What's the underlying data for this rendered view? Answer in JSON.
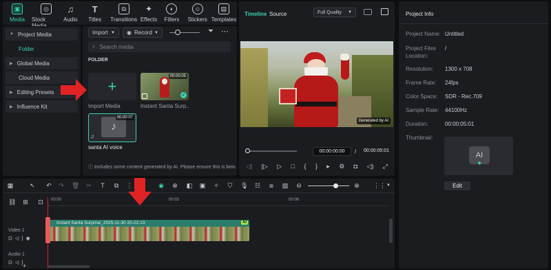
{
  "toolbar": {
    "tabs": [
      {
        "label": "Media",
        "icon": "media-icon"
      },
      {
        "label": "Stock Media",
        "icon": "stock-media-icon"
      },
      {
        "label": "Audio",
        "icon": "audio-icon"
      },
      {
        "label": "Titles",
        "icon": "titles-icon"
      },
      {
        "label": "Transitions",
        "icon": "transitions-icon"
      },
      {
        "label": "Effects",
        "icon": "effects-icon"
      },
      {
        "label": "Filters",
        "icon": "filters-icon"
      },
      {
        "label": "Stickers",
        "icon": "stickers-icon"
      },
      {
        "label": "Templates",
        "icon": "templates-icon"
      }
    ]
  },
  "sidebar": {
    "items": [
      {
        "label": "Project Media"
      },
      {
        "label": "Folder"
      },
      {
        "label": "Global Media"
      },
      {
        "label": "Cloud Media"
      },
      {
        "label": "Editing Presets"
      },
      {
        "label": "Influence Kit"
      }
    ]
  },
  "media": {
    "import_label": "Import",
    "record_label": "Record",
    "search_placeholder": "Search media",
    "folder_heading": "FOLDER",
    "import_tile_label": "Import Media",
    "clip1": {
      "name": "Instant Santa Surp...",
      "duration": "00:00:05"
    },
    "clip2": {
      "name": "santa AI voice",
      "duration": "00:00:07"
    },
    "notice": "Includes some content generated by AI. Please ensure this is bein."
  },
  "preview": {
    "tab_timeline": "Timeline",
    "tab_source": "Source",
    "quality": "Full Quality",
    "watermark": "Generated by AI",
    "current_time": "00:00:00:00",
    "separator": "/",
    "total_time": "00:00:05:01"
  },
  "project_info": {
    "title": "Project Info",
    "fields": [
      {
        "label": "Project Name:",
        "value": "Untitled"
      },
      {
        "label": "Project Files Location:",
        "value": "/"
      },
      {
        "label": "Resolution:",
        "value": "1300 x 708"
      },
      {
        "label": "Frame Rate:",
        "value": "24fps"
      },
      {
        "label": "Color Space:",
        "value": "SDR - Rec.709"
      },
      {
        "label": "Sample Rate:",
        "value": "44100Hz"
      },
      {
        "label": "Duration:",
        "value": "00:00:05:01"
      },
      {
        "label": "Thumbnail:",
        "value": ""
      }
    ],
    "thumb_text": "AI",
    "edit_label": "Edit"
  },
  "timeline": {
    "ruler": [
      "00:00",
      "00:03",
      "00:06"
    ],
    "clip_label": "Instant Santa Surprise_2025-11-30 20-22-13",
    "clip_badge": "AI",
    "track_video": "Video 1",
    "track_audio": "Audio 1"
  },
  "colors": {
    "accent": "#39d3b2",
    "arrow": "#e02424"
  }
}
